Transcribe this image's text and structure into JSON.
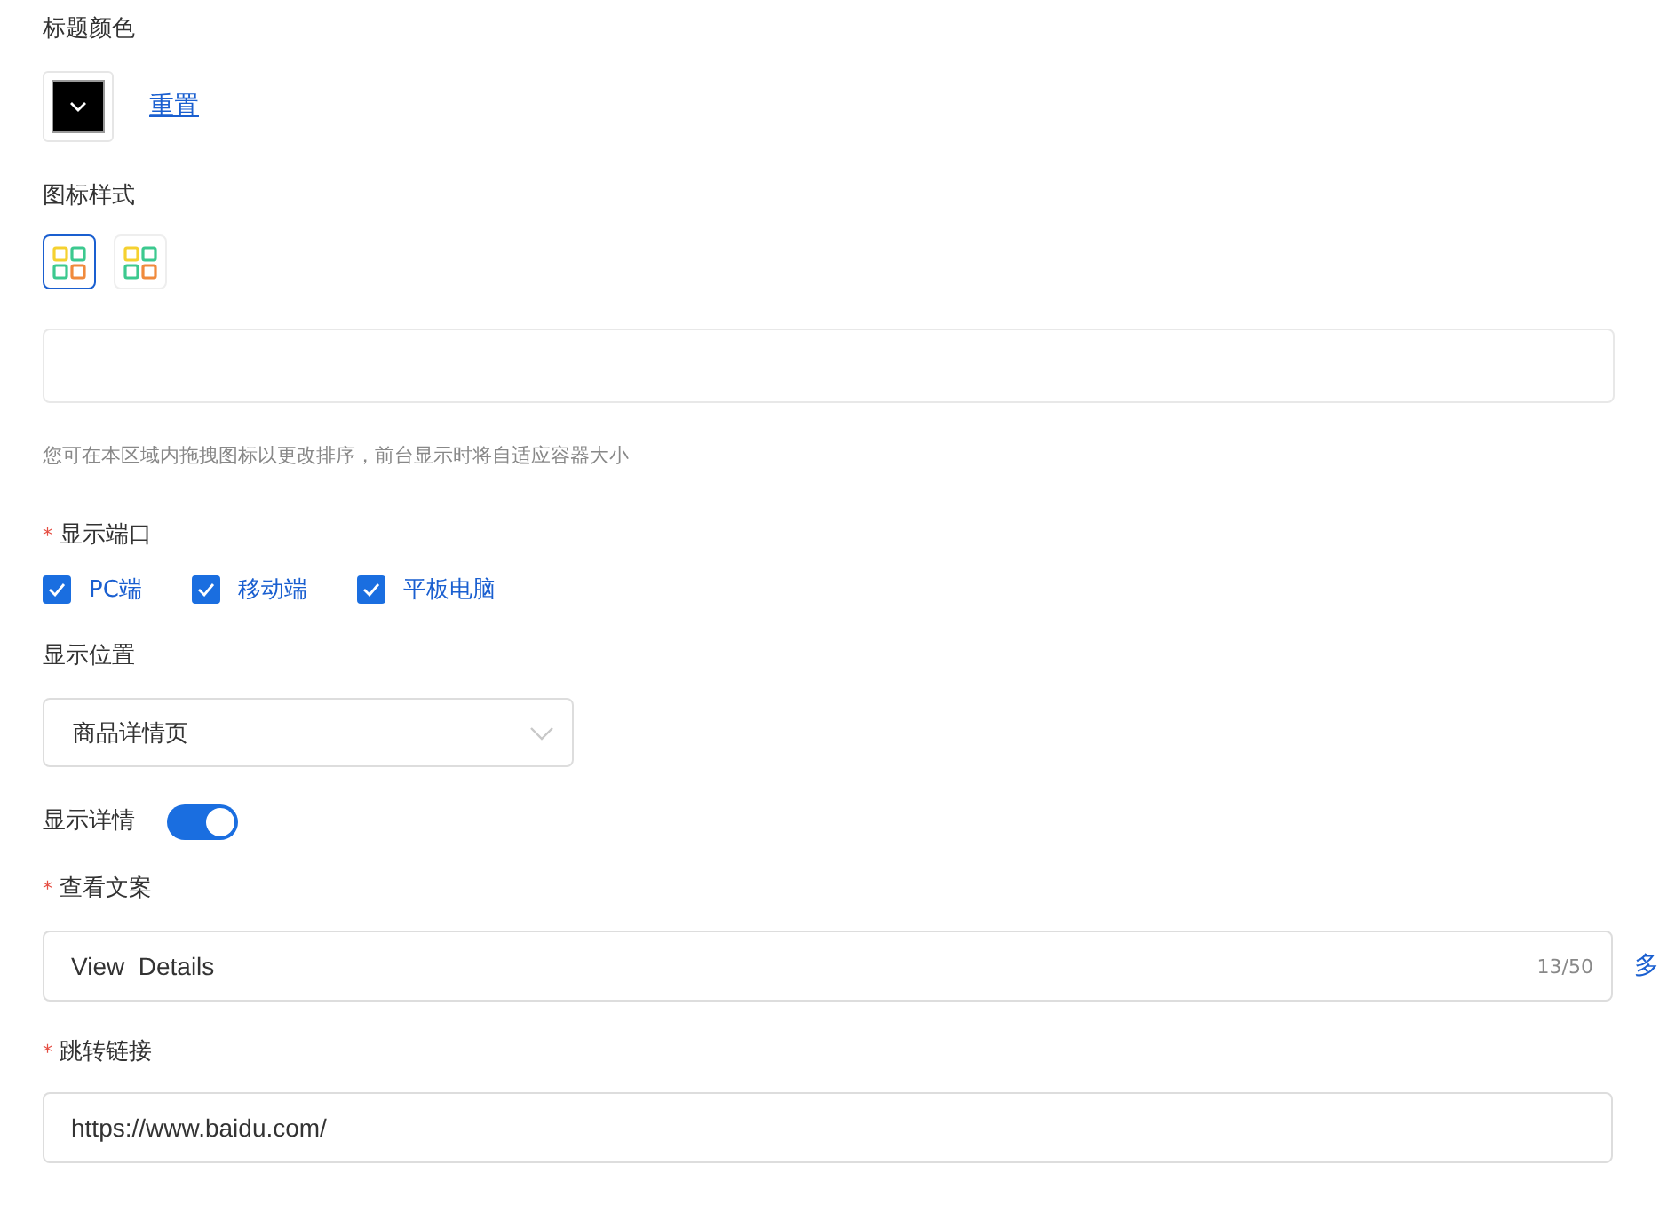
{
  "title_color": {
    "label": "标题颜色",
    "color": "#000000",
    "reset": "重置"
  },
  "icon_style": {
    "label": "图标样式",
    "options": [
      {
        "selected": true
      },
      {
        "selected": false
      }
    ]
  },
  "drag_hint": "您可在本区域内拖拽图标以更改排序，前台显示时将自适应容器大小",
  "display_port": {
    "label": "显示端口",
    "required_mark": "*",
    "options": [
      {
        "label": "PC端",
        "checked": true
      },
      {
        "label": "移动端",
        "checked": true
      },
      {
        "label": "平板电脑",
        "checked": true
      }
    ]
  },
  "display_position": {
    "label": "显示位置",
    "value": "商品详情页"
  },
  "show_details": {
    "label": "显示详情",
    "on": true
  },
  "view_text": {
    "label": "查看文案",
    "required_mark": "*",
    "value": "View  Details",
    "count": "13/50",
    "side_link": "多"
  },
  "jump_link": {
    "label": "跳转链接",
    "required_mark": "*",
    "value": "https://www.baidu.com/"
  }
}
